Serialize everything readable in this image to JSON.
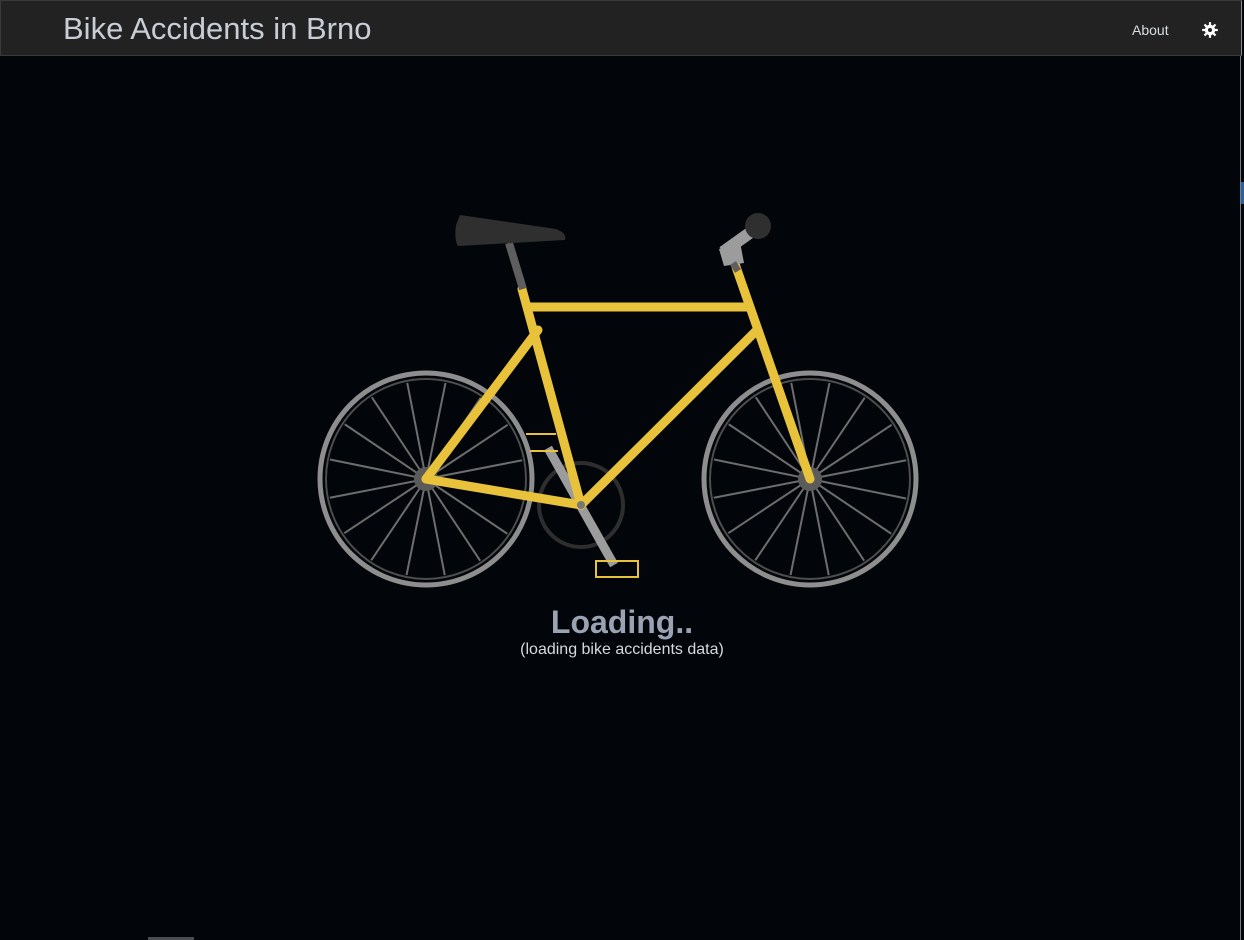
{
  "navbar": {
    "brand": "Bike Accidents in Brno",
    "about_label": "About",
    "settings_icon": "gear-icon"
  },
  "loader": {
    "title": "Loading..",
    "subtitle": "(loading bike accidents data)",
    "illustration": "bicycle-icon"
  },
  "colors": {
    "background": "#02050a",
    "navbar": "#222222",
    "frame": "#e8c23a",
    "wheel": "#8e8e8e",
    "loading_text": "#9aa3b3"
  }
}
